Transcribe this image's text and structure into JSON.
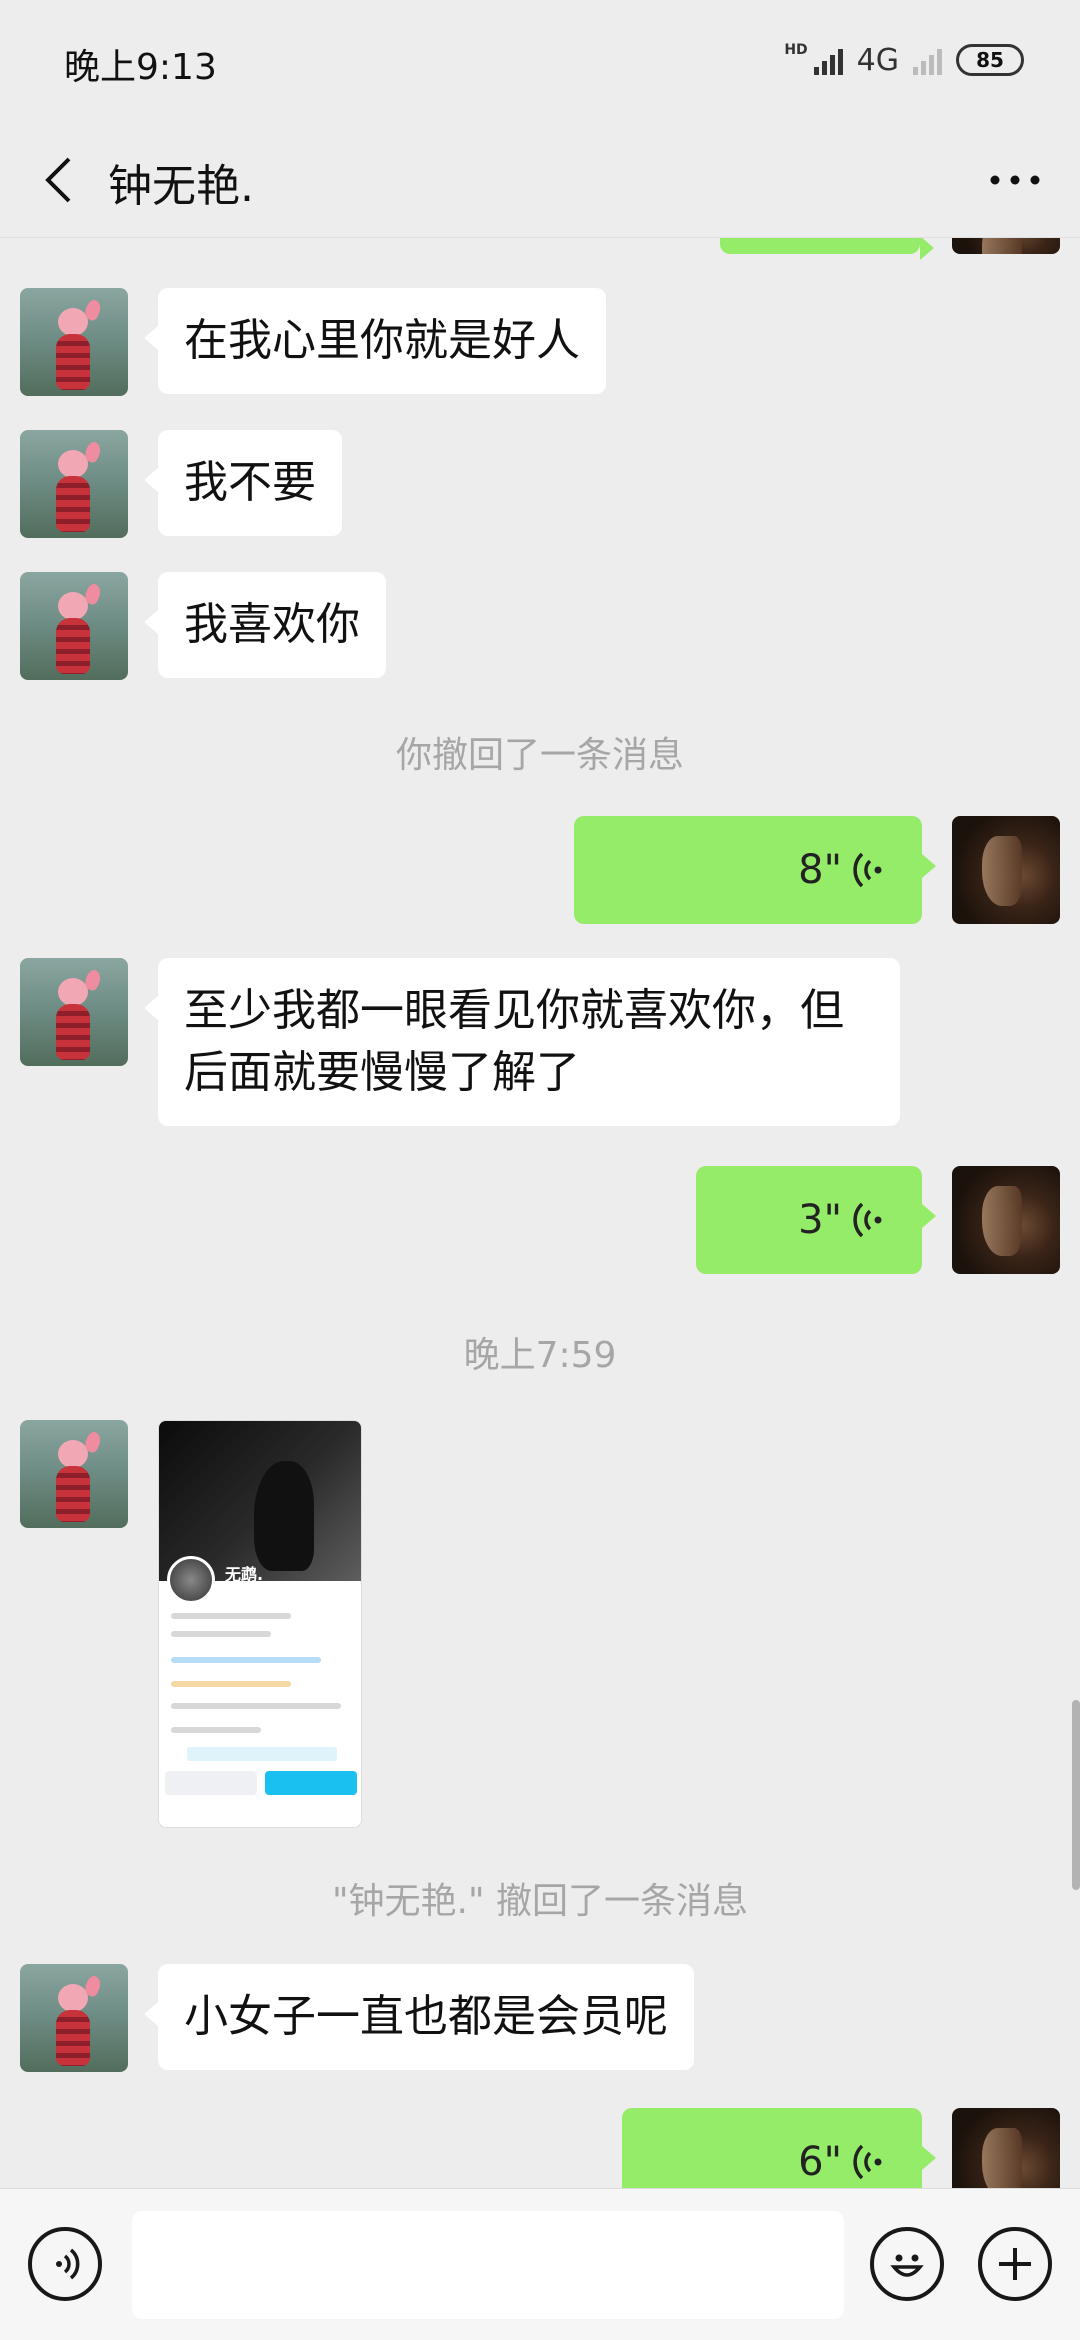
{
  "status_bar": {
    "time": "晚上9:13",
    "network": "4G",
    "hd_label": "HD",
    "battery": "85"
  },
  "header": {
    "title": "钟无艳.",
    "back_icon": "chevron-left-icon",
    "more_icon": "more-dots-icon"
  },
  "messages": [
    {
      "type": "text",
      "side": "left",
      "text": "在我心里你就是好人"
    },
    {
      "type": "text",
      "side": "left",
      "text": "我不要"
    },
    {
      "type": "text",
      "side": "left",
      "text": "我喜欢你"
    },
    {
      "type": "system",
      "text": "你撤回了一条消息"
    },
    {
      "type": "voice",
      "side": "right",
      "duration": "8\""
    },
    {
      "type": "text",
      "side": "left",
      "lines": [
        "至少我都一眼看见你就喜欢你，但",
        "后面就要慢慢了解了"
      ]
    },
    {
      "type": "voice",
      "side": "right",
      "duration": "3\""
    },
    {
      "type": "time",
      "text": "晚上7:59"
    },
    {
      "type": "image",
      "side": "left",
      "description_name": "screenshot-image",
      "inner_name": "无鹉."
    },
    {
      "type": "system",
      "text": "\"钟无艳.\" 撤回了一条消息"
    },
    {
      "type": "text",
      "side": "left",
      "text": "小女子一直也都是会员呢"
    },
    {
      "type": "voice",
      "side": "right",
      "duration": "6\""
    }
  ],
  "input_bar": {
    "voice_icon": "voice-mode-icon",
    "emoji_icon": "emoji-icon",
    "plus_icon": "plus-icon",
    "text_value": ""
  },
  "colors": {
    "background": "#ededed",
    "bubble_left": "#ffffff",
    "bubble_right": "#95ec69",
    "system_text": "#a6a6a6"
  }
}
